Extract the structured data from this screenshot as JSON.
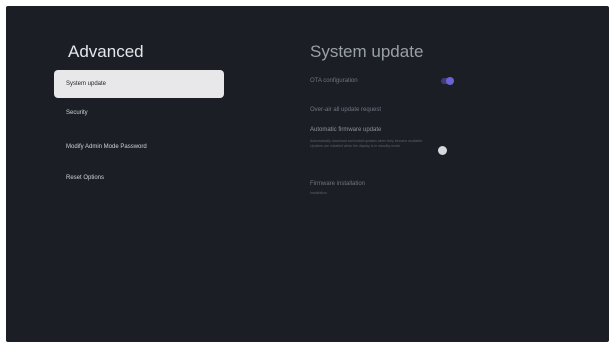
{
  "left_panel": {
    "title": "Advanced",
    "items": [
      {
        "label": "System update",
        "selected": true
      },
      {
        "label": "Security",
        "selected": false
      },
      {
        "label": "Modify Admin Mode Password",
        "selected": false
      },
      {
        "label": "Reset Options",
        "selected": false
      }
    ]
  },
  "right_panel": {
    "title": "System update",
    "rows": [
      {
        "label": "OTA configuration",
        "toggle": "on"
      },
      {
        "label": "Over-air all update request"
      },
      {
        "label": "Automatic firmware update",
        "description": "Automatically download and install updates when they become available. Updates are installed when the display is in standby mode.",
        "toggle": "off"
      },
      {
        "label": "Firmware installation",
        "sublabel": "Installation"
      }
    ]
  },
  "colors": {
    "background": "#1b1e25",
    "selected_item": "#e8e8ea",
    "accent": "#6a63d6"
  }
}
